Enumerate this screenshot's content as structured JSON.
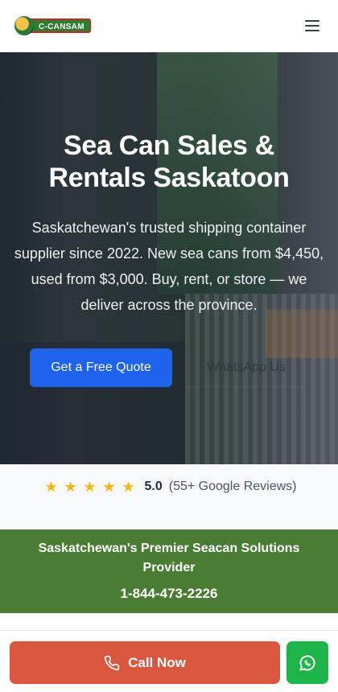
{
  "header": {
    "logo_text": "C-CANSAM",
    "logo_icon": "pelican-logo-icon",
    "menu_icon": "hamburger-menu-icon"
  },
  "hero": {
    "title": "Sea Can Sales & Rentals Saskatoon",
    "subtitle": "Saskatchewan's trusted shipping container supplier since 2022. New sea cans from $4,450, used from $3,000. Buy, rent, or store — we deliver across the province.",
    "primary_button": "Get a Free Quote",
    "secondary_button": "WhatsApp Us"
  },
  "reviews": {
    "star_count": 5,
    "rating": "5.0",
    "count_text": "(55+ Google Reviews)"
  },
  "banner": {
    "title": "Saskatchewan's Premier Seacan Solutions Provider",
    "phone": "1-844-473-2226"
  },
  "bottom_bar": {
    "call_label": "Call Now",
    "call_icon": "phone-icon",
    "whatsapp_icon": "whatsapp-icon"
  },
  "colors": {
    "primary_blue": "#1d63ed",
    "banner_green": "#4a7c34",
    "call_red": "#d9573f",
    "whatsapp_green": "#1db54a",
    "star_yellow": "#f5b50a"
  }
}
